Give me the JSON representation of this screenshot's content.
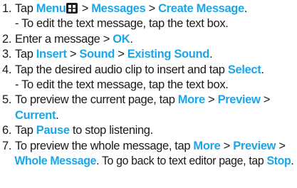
{
  "colors": {
    "keyword": "#1aa6e8",
    "text": "#1a1a1a"
  },
  "steps": [
    {
      "number": "1.",
      "parts": [
        {
          "t": "Tap "
        },
        {
          "k": "Menu"
        },
        {
          "icon": "menu-grid-icon"
        },
        {
          "t": " > "
        },
        {
          "k": "Messages"
        },
        {
          "t": " > "
        },
        {
          "k": "Create Message"
        },
        {
          "t": "."
        }
      ],
      "subs": [
        [
          {
            "t": "- To edit the text message, tap the text box."
          }
        ]
      ]
    },
    {
      "number": "2.",
      "parts": [
        {
          "t": "Enter a message > "
        },
        {
          "k": "OK"
        },
        {
          "t": "."
        }
      ]
    },
    {
      "number": "3.",
      "parts": [
        {
          "t": "Tap "
        },
        {
          "k": "Insert"
        },
        {
          "t": " > "
        },
        {
          "k": "Sound"
        },
        {
          "t": " > "
        },
        {
          "k": "Existing Sound"
        },
        {
          "t": "."
        }
      ]
    },
    {
      "number": "4.",
      "parts": [
        {
          "t": "Tap the desired audio clip to insert and tap "
        },
        {
          "k": "Select"
        },
        {
          "t": "."
        }
      ],
      "subs": [
        [
          {
            "t": "- To edit the text message, tap the text box."
          }
        ]
      ]
    },
    {
      "number": "5.",
      "parts": [
        {
          "t": "To preview the current page, tap "
        },
        {
          "k": "More"
        },
        {
          "t": " > "
        },
        {
          "k": "Preview"
        },
        {
          "t": " >"
        }
      ],
      "subs": [
        [
          {
            "k": "Current"
          },
          {
            "t": "."
          }
        ]
      ]
    },
    {
      "number": "6.",
      "parts": [
        {
          "t": "Tap "
        },
        {
          "k": "Pause"
        },
        {
          "t": " to stop listening."
        }
      ]
    },
    {
      "number": "7.",
      "parts": [
        {
          "t": "To preview the whole message, tap "
        },
        {
          "k": "More"
        },
        {
          "t": " > "
        },
        {
          "k": "Preview"
        },
        {
          "t": " >"
        }
      ],
      "subs": [
        [
          {
            "k": "Whole Message"
          },
          {
            "t": ". To go back to text editor page, tap "
          },
          {
            "k": "Stop"
          },
          {
            "t": "."
          }
        ]
      ]
    }
  ]
}
